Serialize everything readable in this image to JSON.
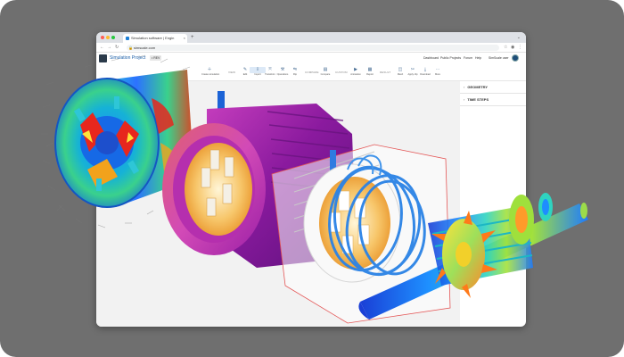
{
  "browser": {
    "tab_title": "Simulation software | Engin",
    "tab_close": "×",
    "new_tab": "+",
    "url": "simscale.com"
  },
  "app": {
    "project_name": "Simulation Project",
    "badge": "• REV",
    "header_links": [
      "Dashboard",
      "Public Projects",
      "Forum",
      "Help",
      "SimScale user"
    ]
  },
  "toolbar": {
    "tools": [
      {
        "label": "Create simulation",
        "icon": "plus-icon"
      },
      {
        "label": "Edit",
        "icon": "pencil-icon"
      },
      {
        "label": "Import",
        "icon": "import-icon"
      },
      {
        "label": "Transform",
        "icon": "transform-icon"
      },
      {
        "label": "Operations",
        "icon": "operations-icon"
      },
      {
        "label": "Flip",
        "icon": "flip-icon"
      },
      {
        "label": "Compare",
        "icon": "compare-icon"
      },
      {
        "label": "Animation",
        "icon": "animation-icon"
      },
      {
        "label": "Report",
        "icon": "report-icon"
      },
      {
        "label": "Mesh",
        "icon": "mesh-icon"
      },
      {
        "label": "Apply clip",
        "icon": "clip-icon"
      },
      {
        "label": "Download",
        "icon": "download-icon"
      },
      {
        "label": "More",
        "icon": "more-icon"
      }
    ],
    "groups": [
      "VIEW",
      "COMPARE",
      "CUSTOM",
      "RESULT"
    ]
  },
  "panel": {
    "items": [
      "GEOMETRY",
      "TIME STEPS"
    ]
  },
  "colors": {
    "stage_bg": "#6f6f6f",
    "accent": "#1c5fa8",
    "housing": "#9b1fa6"
  }
}
